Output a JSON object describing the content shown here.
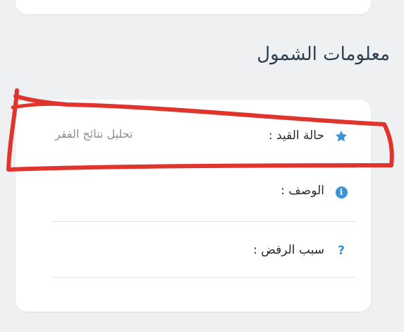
{
  "section": {
    "title": "معلومات الشمول"
  },
  "info_card": {
    "rows": [
      {
        "icon": "star-icon",
        "label": "حالة القيد :",
        "value": "تحليل نتائج الفقر"
      },
      {
        "icon": "info-icon",
        "label": "الوصف :",
        "value": ""
      },
      {
        "icon": "question-icon",
        "label": "سبب الرفض :",
        "value": ""
      }
    ]
  },
  "colors": {
    "background": "#eef0f2",
    "card": "#ffffff",
    "accent_blue": "#3a93d6",
    "annotation_red": "#e0342c"
  }
}
